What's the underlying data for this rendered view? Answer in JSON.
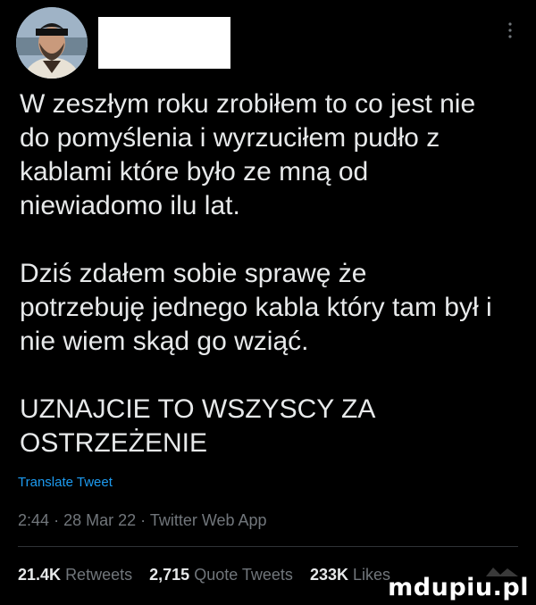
{
  "tweet": {
    "paragraphs": [
      "W zeszłym roku zrobiłem to co jest nie\ndo pomyślenia i wyrzuciłem pudło z\nkablami które było ze mną od\nniewiadomo ilu lat.",
      "Dziś zdałem sobie sprawę że\npotrzebuję jednego kabla który tam był i\nnie wiem skąd go wziąć.",
      "UZNAJCIE TO WSZYSCY ZA\nOSTRZEŻENIE"
    ],
    "translate_label": "Translate Tweet",
    "time": "2:44",
    "date": "28 Mar 22",
    "source": "Twitter Web App",
    "separator": "·"
  },
  "stats": {
    "retweets_count": "21.4K",
    "retweets_label": "Retweets",
    "quotes_count": "2,715",
    "quotes_label": "Quote Tweets",
    "likes_count": "233K",
    "likes_label": "Likes"
  },
  "watermark": "mdupiu.pl",
  "icons": {
    "more": "more-vertical-icon"
  },
  "colors": {
    "background": "#000000",
    "text": "#e7e9ea",
    "secondary": "#71767b",
    "link": "#1d9bf0"
  }
}
